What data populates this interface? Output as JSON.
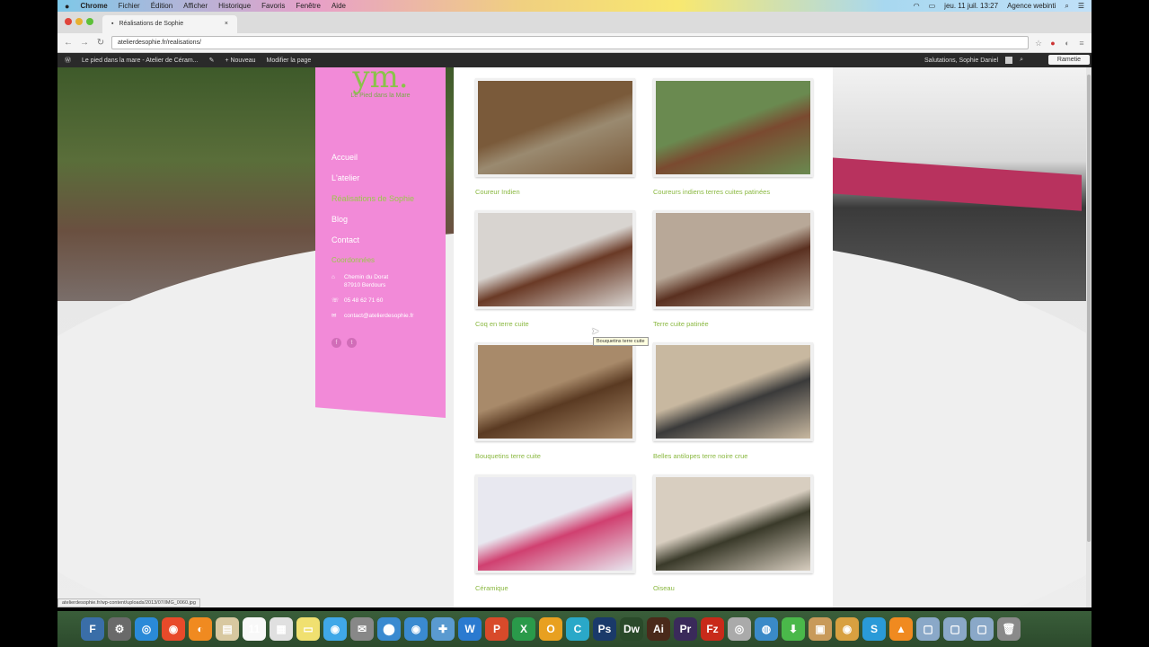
{
  "menubar": {
    "apple": "",
    "app": "Chrome",
    "items": [
      "Fichier",
      "Édition",
      "Afficher",
      "Historique",
      "Favoris",
      "Fenêtre",
      "Aide"
    ],
    "clock": "jeu. 11 juil. 13:27",
    "user": "Agence webinti"
  },
  "browser": {
    "tab_title": "Réalisations de Sophie",
    "url": "atelierdesophie.fr/realisations/"
  },
  "adminbar": {
    "site": "Le pied dans la mare - Atelier de Céram...",
    "new": "+ Nouveau",
    "edit": "Modifier la page",
    "greeting": "Salutations, Sophie Daniel",
    "search_button": "Rametie"
  },
  "sidebar": {
    "logo": "ym.",
    "tagline": "Le Pied dans la Mare",
    "nav": [
      "Accueil",
      "L'atelier",
      "Réalisations de Sophie",
      "Blog",
      "Contact"
    ],
    "contact_title": "Coordonnées",
    "address_line1": "Chemin du Dorat",
    "address_line2": "87910 Berdours",
    "phone": "05 48 62 71 60",
    "email": "contact@atelierdesophie.fr",
    "social": [
      "f",
      "t"
    ]
  },
  "gallery": [
    {
      "caption": "Coureur Indien",
      "colors": [
        "#7a5a3a",
        "#9a8a70"
      ]
    },
    {
      "caption": "Coureurs indiens terres cuites patinées",
      "colors": [
        "#6a8a50",
        "#7a4a30"
      ]
    },
    {
      "caption": "Coq en terre cuite",
      "colors": [
        "#d8d4d0",
        "#6a3a26"
      ]
    },
    {
      "caption": "Terre cuite patinée",
      "colors": [
        "#b8a898",
        "#5a3020"
      ]
    },
    {
      "caption": "Bouquetins terre cuite",
      "colors": [
        "#a88a6a",
        "#5a3a22"
      ]
    },
    {
      "caption": "Belles antilopes terre noire crue",
      "colors": [
        "#c8b8a0",
        "#3a3a3a"
      ]
    },
    {
      "caption": "Céramique",
      "colors": [
        "#e8e8f0",
        "#d04070"
      ]
    },
    {
      "caption": "Oiseau",
      "colors": [
        "#d8cec0",
        "#3a3a2a"
      ]
    }
  ],
  "tooltip": "Bouquetins terre cuite",
  "statusbar": "atelierdesophie.fr/wp-content/uploads/2013/07/IMG_0060.jpg",
  "dock": [
    "F",
    "⚙",
    "◎",
    "◉",
    "◐",
    "▤",
    "11",
    "▦",
    "▭",
    "◉",
    "✉",
    "⬤",
    "◉",
    "✚",
    "W",
    "P",
    "X",
    "O",
    "C",
    "Ps",
    "Dw",
    "Ai",
    "Pr",
    "Fz",
    "◎",
    "◍",
    "⬇",
    "▣",
    "◉",
    "S",
    "▲",
    "▢",
    "▢",
    "▢",
    "🗑"
  ]
}
